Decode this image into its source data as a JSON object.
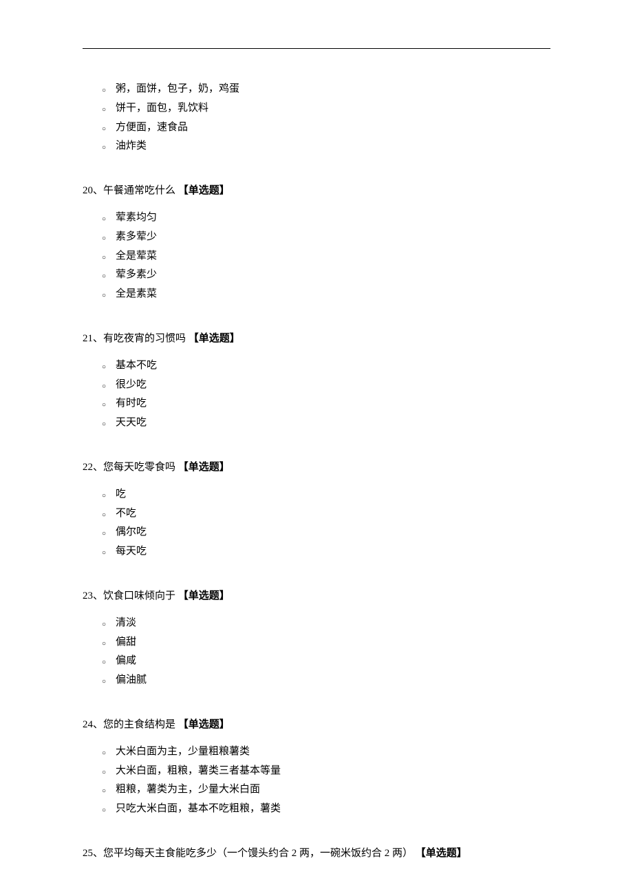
{
  "question_type_label": "【单选题】",
  "orphan_options": [
    "粥，面饼，包子，奶，鸡蛋",
    "饼干，面包，乳饮料",
    "方便面，速食品",
    "油炸类"
  ],
  "questions": [
    {
      "number": "20、",
      "title": "午餐通常吃什么",
      "options": [
        "荤素均匀",
        "素多荤少",
        "全是荤菜",
        "荤多素少",
        "全是素菜"
      ]
    },
    {
      "number": "21、",
      "title": "有吃夜宵的习惯吗",
      "options": [
        "基本不吃",
        "很少吃",
        "有时吃",
        "天天吃"
      ]
    },
    {
      "number": "22、",
      "title": "您每天吃零食吗",
      "options": [
        "吃",
        "不吃",
        "偶尔吃",
        "每天吃"
      ]
    },
    {
      "number": "23、",
      "title": "饮食口味倾向于",
      "options": [
        "清淡",
        "偏甜",
        "偏咸",
        "偏油腻"
      ]
    },
    {
      "number": "24、",
      "title": "您的主食结构是",
      "options": [
        "大米白面为主，少量粗粮薯类",
        "大米白面，粗粮，薯类三者基本等量",
        "粗粮，薯类为主，少量大米白面",
        "只吃大米白面，基本不吃粗粮，薯类"
      ]
    },
    {
      "number": "25、",
      "title": "您平均每天主食能吃多少（一个馒头约合 2 两，一碗米饭约合 2 两）",
      "options": []
    }
  ]
}
